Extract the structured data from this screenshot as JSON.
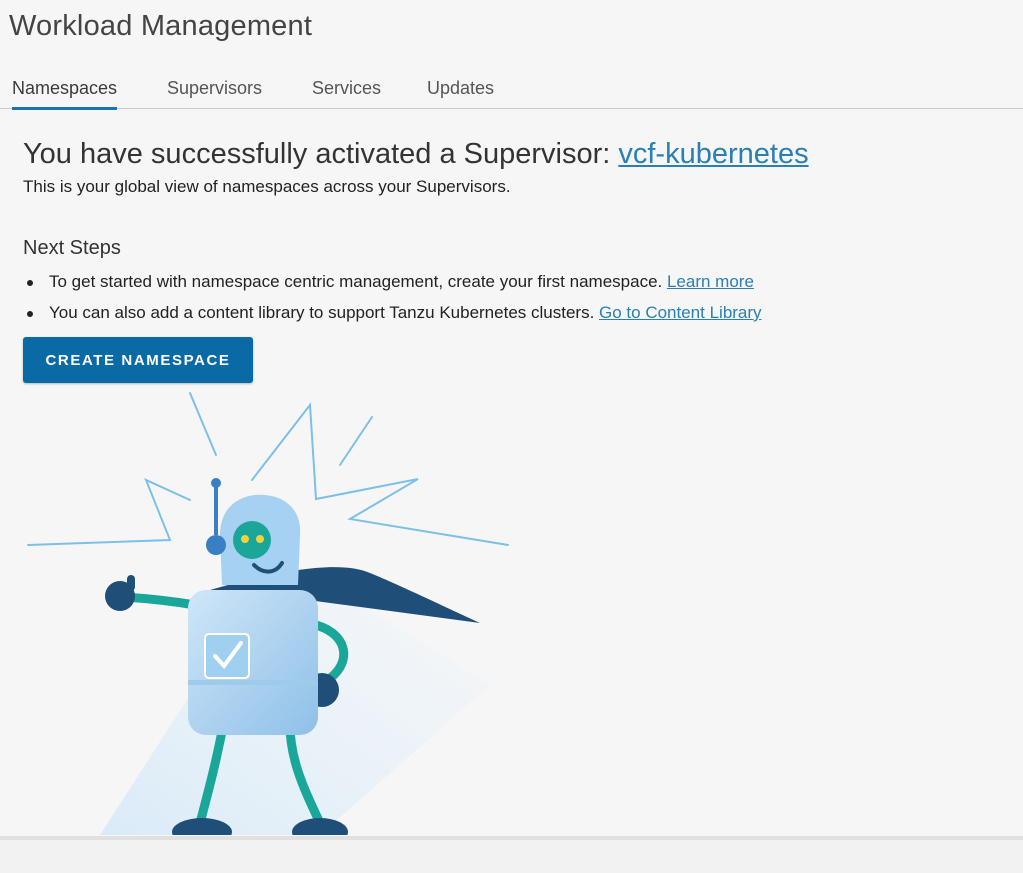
{
  "page": {
    "title": "Workload Management"
  },
  "tabs": [
    {
      "label": "Namespaces",
      "active": true
    },
    {
      "label": "Supervisors",
      "active": false
    },
    {
      "label": "Services",
      "active": false
    },
    {
      "label": "Updates",
      "active": false
    }
  ],
  "banner": {
    "headline_prefix": "You have successfully activated a Supervisor: ",
    "supervisor_link": "vcf-kubernetes",
    "subtitle": "This is your global view of namespaces across your Supervisors."
  },
  "next_steps": {
    "title": "Next Steps",
    "items": [
      {
        "text": "To get started with namespace centric management, create your first namespace. ",
        "link": "Learn more"
      },
      {
        "text": "You can also add a content library to support Tanzu Kubernetes clusters. ",
        "link": "Go to Content Library"
      }
    ]
  },
  "actions": {
    "create_namespace": "CREATE NAMESPACE"
  },
  "illustration": {
    "icon": "robot-hero-illustration"
  },
  "colors": {
    "accent": "#0a6aa6",
    "link": "#2a7fb4",
    "tab_indicator": "#1a73b5",
    "robot_body": "#bcdcf3",
    "cape": "#1f4e79",
    "limb": "#1aa79a"
  }
}
